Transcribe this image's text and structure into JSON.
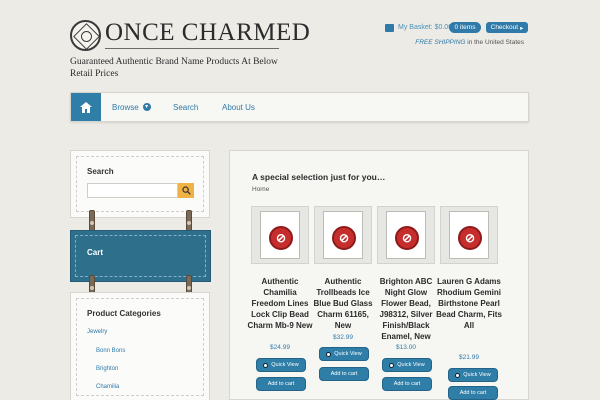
{
  "header": {
    "logo_text": "ONCE CHARMED",
    "tagline": "Guaranteed Authentic Brand Name Products At Below Retail Prices",
    "basket_label": "My Basket: $0.00",
    "items_label": "0 items",
    "checkout_label": "Checkout",
    "free_shipping_em": "FREE SHIPPING",
    "free_shipping_rest": " in the United States"
  },
  "nav": {
    "home_icon": "home-icon",
    "items": [
      {
        "label": "Browse",
        "has_dropdown": true
      },
      {
        "label": "Search"
      },
      {
        "label": "About Us"
      }
    ]
  },
  "sidebar": {
    "search_title": "Search",
    "search_placeholder": "",
    "cart_title": "Cart",
    "categories_title": "Product Categories",
    "categories": [
      "Jewelry",
      "Bonn Bons",
      "Brighton",
      "Chamilia"
    ]
  },
  "main": {
    "title": "A special selection just for you…",
    "breadcrumb": "Home",
    "products": [
      {
        "name": "Authentic Chamilia Freedom Lines Lock Clip Bead Charm Mb-9 New",
        "price": "$24.99",
        "quick_view": "Quick View",
        "add_to_cart": "Add to cart"
      },
      {
        "name": "Authentic Trollbeads Ice Blue Bud Glass Charm 61165, New",
        "price": "$32.99",
        "quick_view": "Quick View",
        "add_to_cart": "Add to cart"
      },
      {
        "name": "Brighton ABC Night Glow Flower Bead, J98312, Silver Finish/Black Enamel, New",
        "price": "$13.00",
        "quick_view": "Quick View",
        "add_to_cart": "Add to cart"
      },
      {
        "name": "Lauren G Adams Rhodium Gemini Birthstone Pearl Bead Charm, Fits All",
        "price": "$21.99",
        "quick_view": "Quick View",
        "add_to_cart": "Add to cart"
      }
    ]
  }
}
